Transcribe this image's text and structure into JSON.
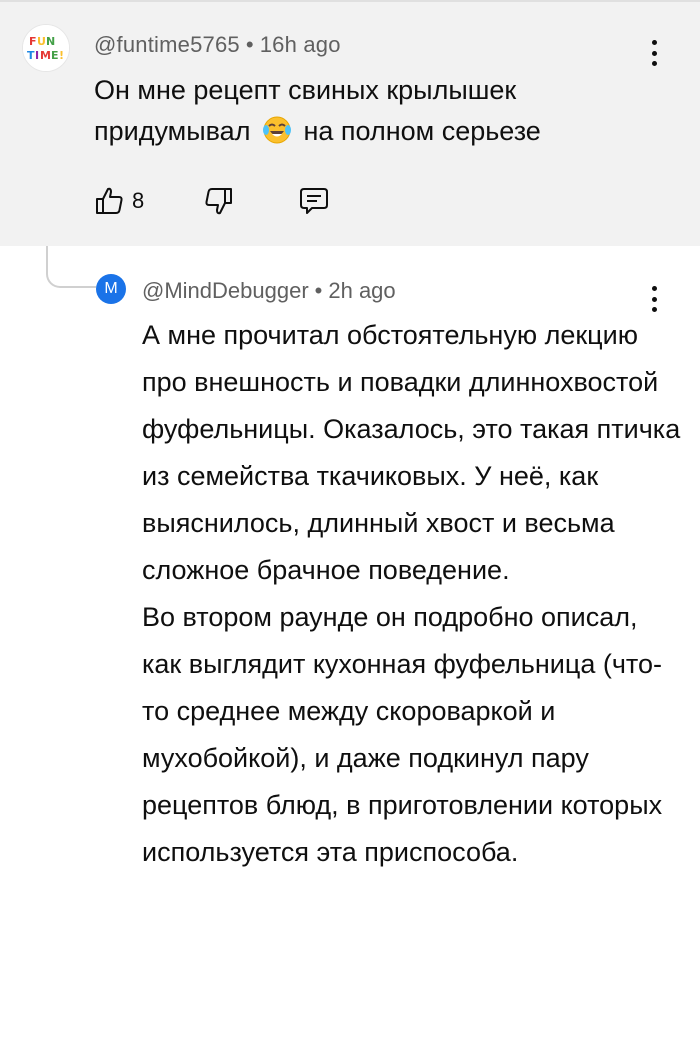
{
  "top_comment": {
    "author": "@funtime5765",
    "separator": "•",
    "time": "16h ago",
    "text_line1": "Он мне рецепт свиных крылышек",
    "text_line2_before": "придумывал",
    "emoji_icon": "face-with-tears-of-joy-icon",
    "text_line2_after": "на полном серьезе",
    "like_count": "8",
    "background_color": "#f2f2f2"
  },
  "reply": {
    "avatar_letter": "M",
    "avatar_color": "#1a73e8",
    "author": "@MindDebugger",
    "separator": "•",
    "time": "2h ago",
    "paragraph1": "А мне прочитал обстоятельную лекцию про внешность и повадки длиннохвостой фуфельницы. Оказалось, это такая птичка из семейства ткачиковых. У неё, как выяснилось, длинный хвост и весьма сложное брачное поведение.",
    "paragraph2": "Во втором раунде он подробно описал, как выглядит кухонная фуфельница (что-то среднее между скороваркой и мухобойкой), и даже подкинул пару рецептов блюд, в приготовлении которых используется эта приспособа."
  }
}
